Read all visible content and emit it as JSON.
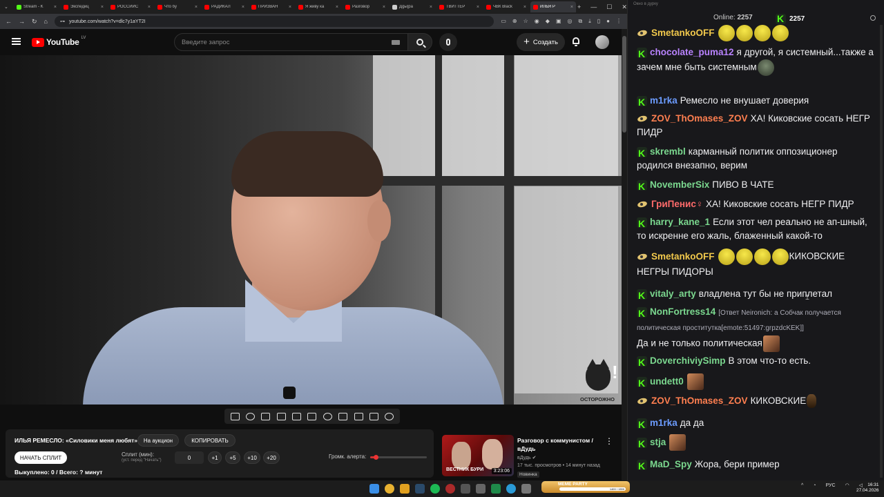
{
  "browser": {
    "tabs": [
      {
        "title": "Stream - K",
        "color": "#53fc18"
      },
      {
        "title": "Экспедиц",
        "color": "#ff0000"
      },
      {
        "title": "РОССИЙС",
        "color": "#ff0000"
      },
      {
        "title": "Что бу",
        "color": "#ff0000"
      },
      {
        "title": "РАДИКАЛ",
        "color": "#ff0000"
      },
      {
        "title": "ПРИЗВАН",
        "color": "#ff0000"
      },
      {
        "title": "Я живу ка",
        "color": "#ff0000"
      },
      {
        "title": "Разговор",
        "color": "#ff0000"
      },
      {
        "title": "Дgы|pа",
        "color": "#cccccc"
      },
      {
        "title": "ТВИТТЕР",
        "color": "#ff0000"
      },
      {
        "title": "ЧВК Black",
        "color": "#ff0000"
      },
      {
        "title": "ИЛЬЯ Р",
        "color": "#ff0000",
        "active": true
      }
    ],
    "url": "youtube.com/watch?v=dlc7y1aYT2I"
  },
  "youtube": {
    "logo_text": "YouTube",
    "country_code": "LV",
    "search_placeholder": "Введите запрос",
    "create_label": "Создать"
  },
  "video": {
    "watermark_label": "ОСТОРОЖНО"
  },
  "panel": {
    "title": "ИЛЬЯ РЕМЕСЛО: «Силовики меня любят»",
    "auction_btn": "На аукцион",
    "copy_btn": "КОПИРОВАТЬ",
    "start_split_btn": "НАЧАТЬ СПЛИТ",
    "split_label": "Сплит (мин):",
    "split_hint": "(уст. перед \"Начать\")",
    "split_value": "0",
    "increments": [
      "+1",
      "+5",
      "+10",
      "+20"
    ],
    "volume_label": "Громк. алерта:",
    "volume_level": 0.1,
    "bought_text": "Выкуплено: 0 / Всего: ? минут"
  },
  "recommendation": {
    "thumb_text": "ВЕСТНИК БУРИ",
    "duration": "3:23:06",
    "title": "Разговор с коммунистом / вДудь",
    "channel": "вДудь",
    "meta": "17 тыс. просмотров • 14 минут назад",
    "badge": "Новинка"
  },
  "chat": {
    "window_title": "Окно в дурку",
    "online_label": "Online:",
    "online_count": "2257",
    "viewer_count": "2257",
    "messages": [
      {
        "badge": "sub",
        "user": "SmetankoOFF",
        "user_color": "#f2c94c",
        "text": "",
        "emotes": 4,
        "emote_kind": "yel"
      },
      {
        "badge": "kick",
        "user": "chocolate_puma12",
        "user_color": "#b983ff",
        "text": "я другой, я системный...также а зачем мне быть системным",
        "emotes": 1,
        "emote_kind": "dark"
      },
      {
        "badge": "kick",
        "user": "m1rka",
        "user_color": "#6c9cff",
        "text": "Ремесло не внушает доверия"
      },
      {
        "badge": "sub",
        "user": "ZOV_ThOmases_ZOV",
        "user_color": "#ff7f50",
        "text": "ХА! Киковские сосать НЕГР ПИДР"
      },
      {
        "badge": "kick",
        "user": "skrembl",
        "user_color": "#7bd88f",
        "text": "карманный политик оппозиционер родился внезапно, верим"
      },
      {
        "badge": "kick",
        "user": "NovemberSix",
        "user_color": "#7bd88f",
        "text": "ПИВО В ЧАТЕ"
      },
      {
        "badge": "sub",
        "user": "ГриПенис♀",
        "user_color": "#ff6b6b",
        "text": "ХА! Киковские сосать НЕГР ПИДР"
      },
      {
        "badge": "kick",
        "user": "harry_kane_1",
        "user_color": "#7bd88f",
        "text": "Если этот чел реально не ап-шный, то искренне его жаль, блаженный какой-то"
      },
      {
        "badge": "sub",
        "user": "SmetankoOFF",
        "user_color": "#f2c94c",
        "text": "КИКОВСКИЕ НЕГРЫ ПИДОРЫ",
        "emotes": 4,
        "emote_kind": "yel"
      },
      {
        "badge": "kick",
        "user": "vitaly_arty",
        "user_color": "#7bd88f",
        "text": "владлена тут бы не приплетал"
      },
      {
        "badge": "kick",
        "user": "NonFortress14",
        "user_color": "#7bd88f",
        "reply": "[Ответ Neironich: а Собчак получается политическая проституткa[emote:51497:grpzdcKEK]]",
        "text": "Да и не только политическая",
        "emotes": 1,
        "emote_kind": "face"
      },
      {
        "badge": "kick",
        "user": "DoverchiviySimp",
        "user_color": "#7bd88f",
        "text": "В этом что-то есть."
      },
      {
        "badge": "kick",
        "user": "undett0",
        "user_color": "#7bd88f",
        "text": "",
        "emotes": 1,
        "emote_kind": "face"
      },
      {
        "badge": "sub",
        "user": "ZOV_ThOmases_ZOV",
        "user_color": "#ff7f50",
        "text": "КИКОВСКИЕ",
        "emotes": 1,
        "emote_kind": "small"
      },
      {
        "badge": "kick",
        "user": "m1rka",
        "user_color": "#6c9cff",
        "text": "да да"
      },
      {
        "badge": "kick",
        "user": "stja",
        "user_color": "#7bd88f",
        "text": "",
        "emotes": 1,
        "emote_kind": "face"
      },
      {
        "badge": "kick",
        "user": "MaD_Spy",
        "user_color": "#7bd88f",
        "text": "Жора, бери пример"
      }
    ]
  },
  "taskbar": {
    "meme_party_label": "MEME PARTY",
    "meme_party_progress": "1400 / 1500",
    "lang": "РУС",
    "time": "16:31",
    "date": "27.04.2026"
  }
}
